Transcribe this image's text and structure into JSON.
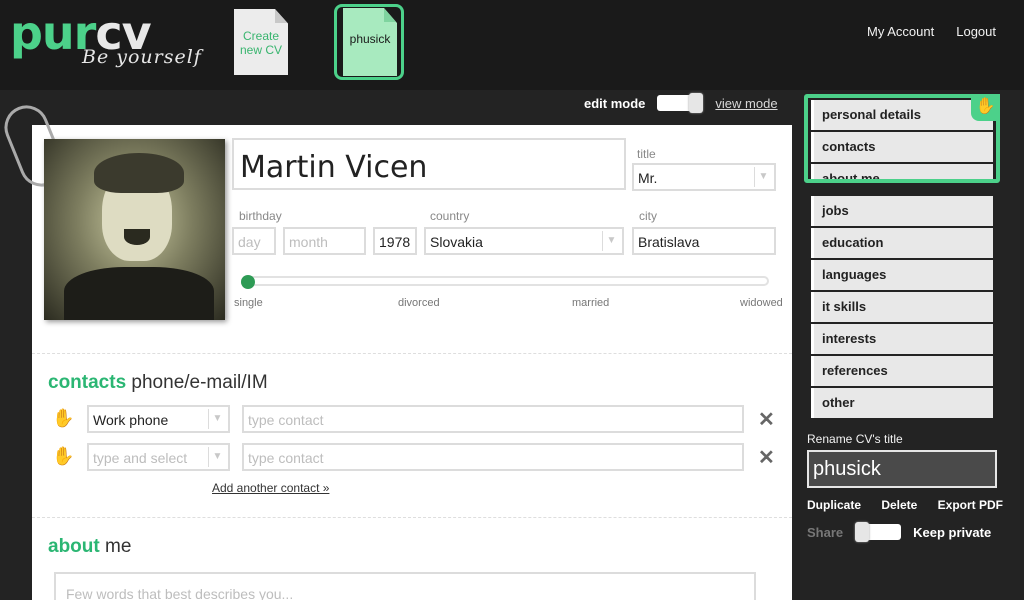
{
  "header": {
    "logo_left": "pur",
    "logo_right": "cv",
    "tagline": "Be yourself",
    "create_doc_label": "Create new CV",
    "active_doc_label": "phusick",
    "links": [
      "My Account",
      "Logout"
    ]
  },
  "mode": {
    "edit": "edit mode",
    "view": "view mode"
  },
  "personal": {
    "name": "Martin Vicen",
    "title_label": "title",
    "title_value": "Mr.",
    "birthday_label": "birthday",
    "day_placeholder": "day",
    "month_placeholder": "month",
    "year": "1978",
    "country_label": "country",
    "country_value": "Slovakia",
    "city_label": "city",
    "city_value": "Bratislava",
    "marital_status": [
      "single",
      "divorced",
      "married",
      "widowed"
    ],
    "marital_selected_index": 0
  },
  "contacts": {
    "title_accent": "contacts",
    "title_rest": "phone/e-mail/IM",
    "rows": [
      {
        "type": "Work phone",
        "type_is_placeholder": false,
        "contact_placeholder": "type contact"
      },
      {
        "type": "type and select",
        "type_is_placeholder": true,
        "contact_placeholder": "type contact"
      }
    ],
    "add_link": "Add another contact »"
  },
  "about": {
    "title_accent": "about",
    "title_rest": "me",
    "placeholder": "Few words that best describes you..."
  },
  "sidebar": {
    "items": [
      "personal details",
      "contacts",
      "about me",
      "jobs",
      "education",
      "languages",
      "it skills",
      "interests",
      "references",
      "other"
    ],
    "rename_label": "Rename CV's title",
    "rename_value": "phusick",
    "actions": [
      "Duplicate",
      "Delete",
      "Export PDF"
    ],
    "share_label": "Share",
    "keep_private_label": "Keep private"
  },
  "colors": {
    "accent": "#4cd18a",
    "accent_dark": "#2bb673",
    "background": "#232323"
  },
  "icons": {
    "drag": "hand-icon",
    "remove": "close-icon",
    "dropdown": "chevron-down-icon"
  }
}
